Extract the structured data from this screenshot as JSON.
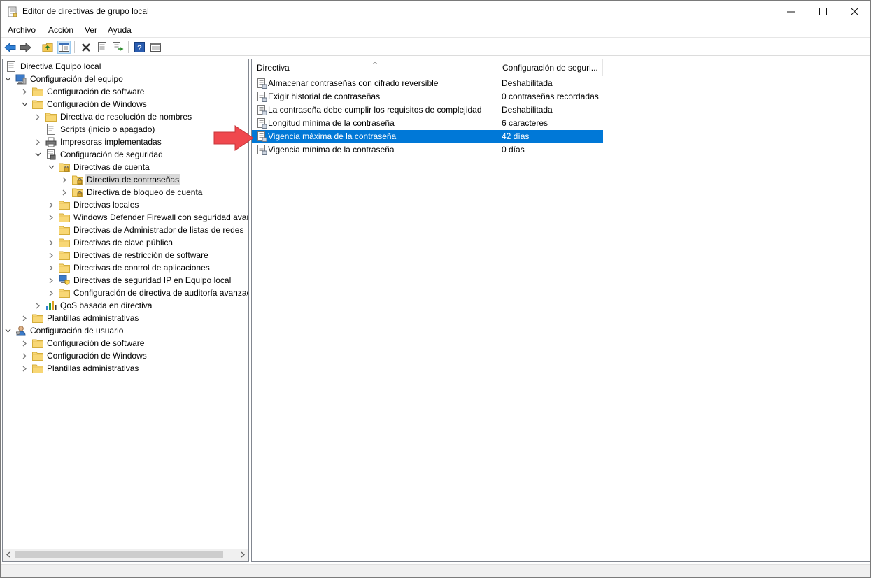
{
  "window": {
    "title": "Editor de directivas de grupo local",
    "controls": {
      "minimize": "—",
      "maximize": "☐",
      "close": "✕"
    }
  },
  "menu": {
    "items": [
      "Archivo",
      "Acción",
      "Ver",
      "Ayuda"
    ]
  },
  "toolbar": {
    "buttons": [
      "back-icon",
      "forward-icon",
      "up-folder-icon",
      "show-hide-tree-icon",
      "delete-icon",
      "properties-icon",
      "export-list-icon",
      "help-icon",
      "mmc-view-icon"
    ]
  },
  "tree": {
    "items": [
      {
        "label": "Directiva Equipo local",
        "level": 0,
        "toggle": "",
        "icon": "policy-doc-icon"
      },
      {
        "label": "Configuración del equipo",
        "level": 0,
        "toggle": "open",
        "icon": "computer-icon"
      },
      {
        "label": "Configuración de software",
        "level": 1,
        "toggle": "closed",
        "icon": "folder-icon"
      },
      {
        "label": "Configuración de Windows",
        "level": 1,
        "toggle": "open",
        "icon": "folder-icon"
      },
      {
        "label": "Directiva de resolución de nombres",
        "level": 2,
        "toggle": "closed",
        "icon": "folder-icon"
      },
      {
        "label": "Scripts (inicio o apagado)",
        "level": 2,
        "toggle": "",
        "icon": "script-icon"
      },
      {
        "label": "Impresoras implementadas",
        "level": 2,
        "toggle": "closed",
        "icon": "printer-icon"
      },
      {
        "label": "Configuración de seguridad",
        "level": 2,
        "toggle": "open",
        "icon": "security-config-icon"
      },
      {
        "label": "Directivas de cuenta",
        "level": 3,
        "toggle": "open",
        "icon": "locked-folder-icon"
      },
      {
        "label": "Directiva de contraseñas",
        "level": 4,
        "toggle": "closed",
        "icon": "locked-folder-icon",
        "selected": true
      },
      {
        "label": "Directiva de bloqueo de cuenta",
        "level": 4,
        "toggle": "closed",
        "icon": "locked-folder-icon"
      },
      {
        "label": "Directivas locales",
        "level": 3,
        "toggle": "closed",
        "icon": "folder-icon"
      },
      {
        "label": "Windows Defender Firewall con seguridad avan.",
        "level": 3,
        "toggle": "closed",
        "icon": "folder-icon"
      },
      {
        "label": "Directivas de Administrador de listas de redes",
        "level": 3,
        "toggle": "",
        "icon": "folder-icon"
      },
      {
        "label": "Directivas de clave pública",
        "level": 3,
        "toggle": "closed",
        "icon": "folder-icon"
      },
      {
        "label": "Directivas de restricción de software",
        "level": 3,
        "toggle": "closed",
        "icon": "folder-icon"
      },
      {
        "label": "Directivas de control de aplicaciones",
        "level": 3,
        "toggle": "closed",
        "icon": "folder-icon"
      },
      {
        "label": "Directivas de seguridad IP en Equipo local",
        "level": 3,
        "toggle": "closed",
        "icon": "ipsec-icon"
      },
      {
        "label": "Configuración de directiva de auditoría avanzac",
        "level": 3,
        "toggle": "closed",
        "icon": "folder-icon"
      },
      {
        "label": "QoS basada en directiva",
        "level": 2,
        "toggle": "closed",
        "icon": "qos-chart-icon"
      },
      {
        "label": "Plantillas administrativas",
        "level": 1,
        "toggle": "closed",
        "icon": "folder-icon"
      },
      {
        "label": "Configuración de usuario",
        "level": 0,
        "toggle": "open",
        "icon": "user-icon"
      },
      {
        "label": "Configuración de software",
        "level": 1,
        "toggle": "closed",
        "icon": "folder-icon"
      },
      {
        "label": "Configuración de Windows",
        "level": 1,
        "toggle": "closed",
        "icon": "folder-icon"
      },
      {
        "label": "Plantillas administrativas",
        "level": 1,
        "toggle": "closed",
        "icon": "folder-icon"
      }
    ]
  },
  "list": {
    "columns": [
      "Directiva",
      "Configuración de seguri..."
    ],
    "rows": [
      {
        "name": "Almacenar contraseñas con cifrado reversible",
        "value": "Deshabilitada"
      },
      {
        "name": "Exigir historial de contraseñas",
        "value": "0 contraseñas recordadas"
      },
      {
        "name": "La contraseña debe cumplir los requisitos de complejidad",
        "value": "Deshabilitada"
      },
      {
        "name": "Longitud mínima de la contraseña",
        "value": "6 caracteres"
      },
      {
        "name": "Vigencia máxima de la contraseña",
        "value": "42 días",
        "selected": true
      },
      {
        "name": "Vigencia mínima de la contraseña",
        "value": "0 días"
      }
    ]
  },
  "colors": {
    "selection": "#0078d7",
    "tree_selection": "#d9d9d9",
    "arrow": "#f0484e",
    "folder": "#f8d775"
  }
}
